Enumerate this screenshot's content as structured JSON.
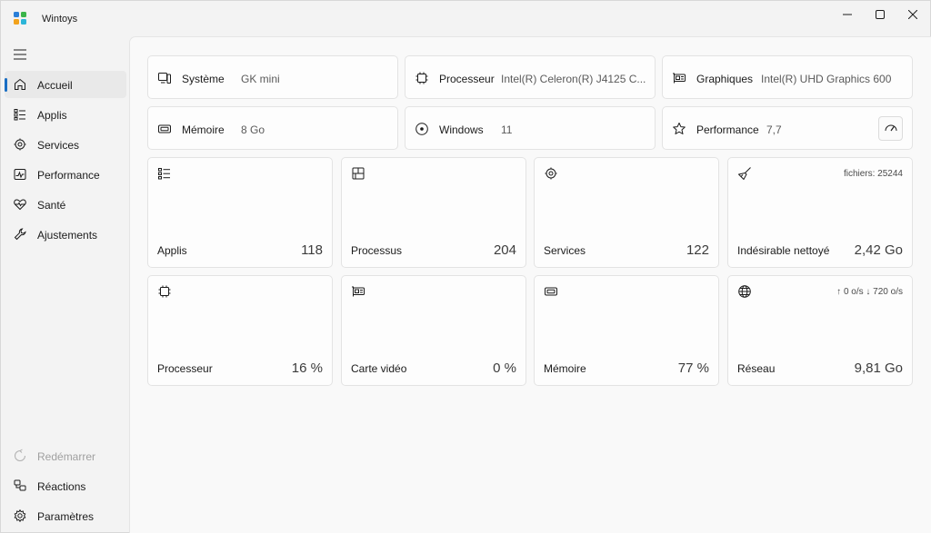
{
  "app": {
    "title": "Wintoys"
  },
  "sidebar": {
    "items": [
      {
        "label": "Accueil",
        "icon": "home-icon"
      },
      {
        "label": "Applis",
        "icon": "apps-list-icon"
      },
      {
        "label": "Services",
        "icon": "services-gear-icon"
      },
      {
        "label": "Performance",
        "icon": "performance-chart-icon"
      },
      {
        "label": "Santé",
        "icon": "heart-pulse-icon"
      },
      {
        "label": "Ajustements",
        "icon": "wrench-icon"
      }
    ],
    "footer": [
      {
        "label": "Redémarrer",
        "icon": "restart-icon"
      },
      {
        "label": "Réactions",
        "icon": "feedback-icon"
      },
      {
        "label": "Paramètres",
        "icon": "settings-gear-icon"
      }
    ]
  },
  "info": {
    "systeme": {
      "label": "Système",
      "value": "GK mini"
    },
    "processeur": {
      "label": "Processeur",
      "value": "Intel(R) Celeron(R) J4125 C..."
    },
    "graphiques": {
      "label": "Graphiques",
      "value": "Intel(R) UHD Graphics 600"
    },
    "memoire": {
      "label": "Mémoire",
      "value": "8 Go"
    },
    "windows": {
      "label": "Windows",
      "value": "11"
    },
    "performance": {
      "label": "Performance",
      "value": "7,7"
    }
  },
  "stats": {
    "applis": {
      "label": "Applis",
      "value": "118"
    },
    "processus": {
      "label": "Processus",
      "value": "204"
    },
    "services": {
      "label": "Services",
      "value": "122"
    },
    "junk": {
      "label": "Indésirable nettoyé",
      "value": "2,42 Go",
      "extra": "fichiers: 25244"
    },
    "cpu": {
      "label": "Processeur",
      "value": "16 %"
    },
    "gpu": {
      "label": "Carte vidéo",
      "value": "0 %"
    },
    "ram": {
      "label": "Mémoire",
      "value": "77 %"
    },
    "network": {
      "label": "Réseau",
      "value": "9,81 Go",
      "extra": "↑ 0 o/s  ↓ 720 o/s"
    }
  },
  "colors": {
    "accent": "#1a6ec3",
    "logo_blue": "#2b7fd8",
    "logo_green": "#3bb54a",
    "logo_orange": "#f2a21c",
    "logo_pink": "#e04f8b"
  }
}
